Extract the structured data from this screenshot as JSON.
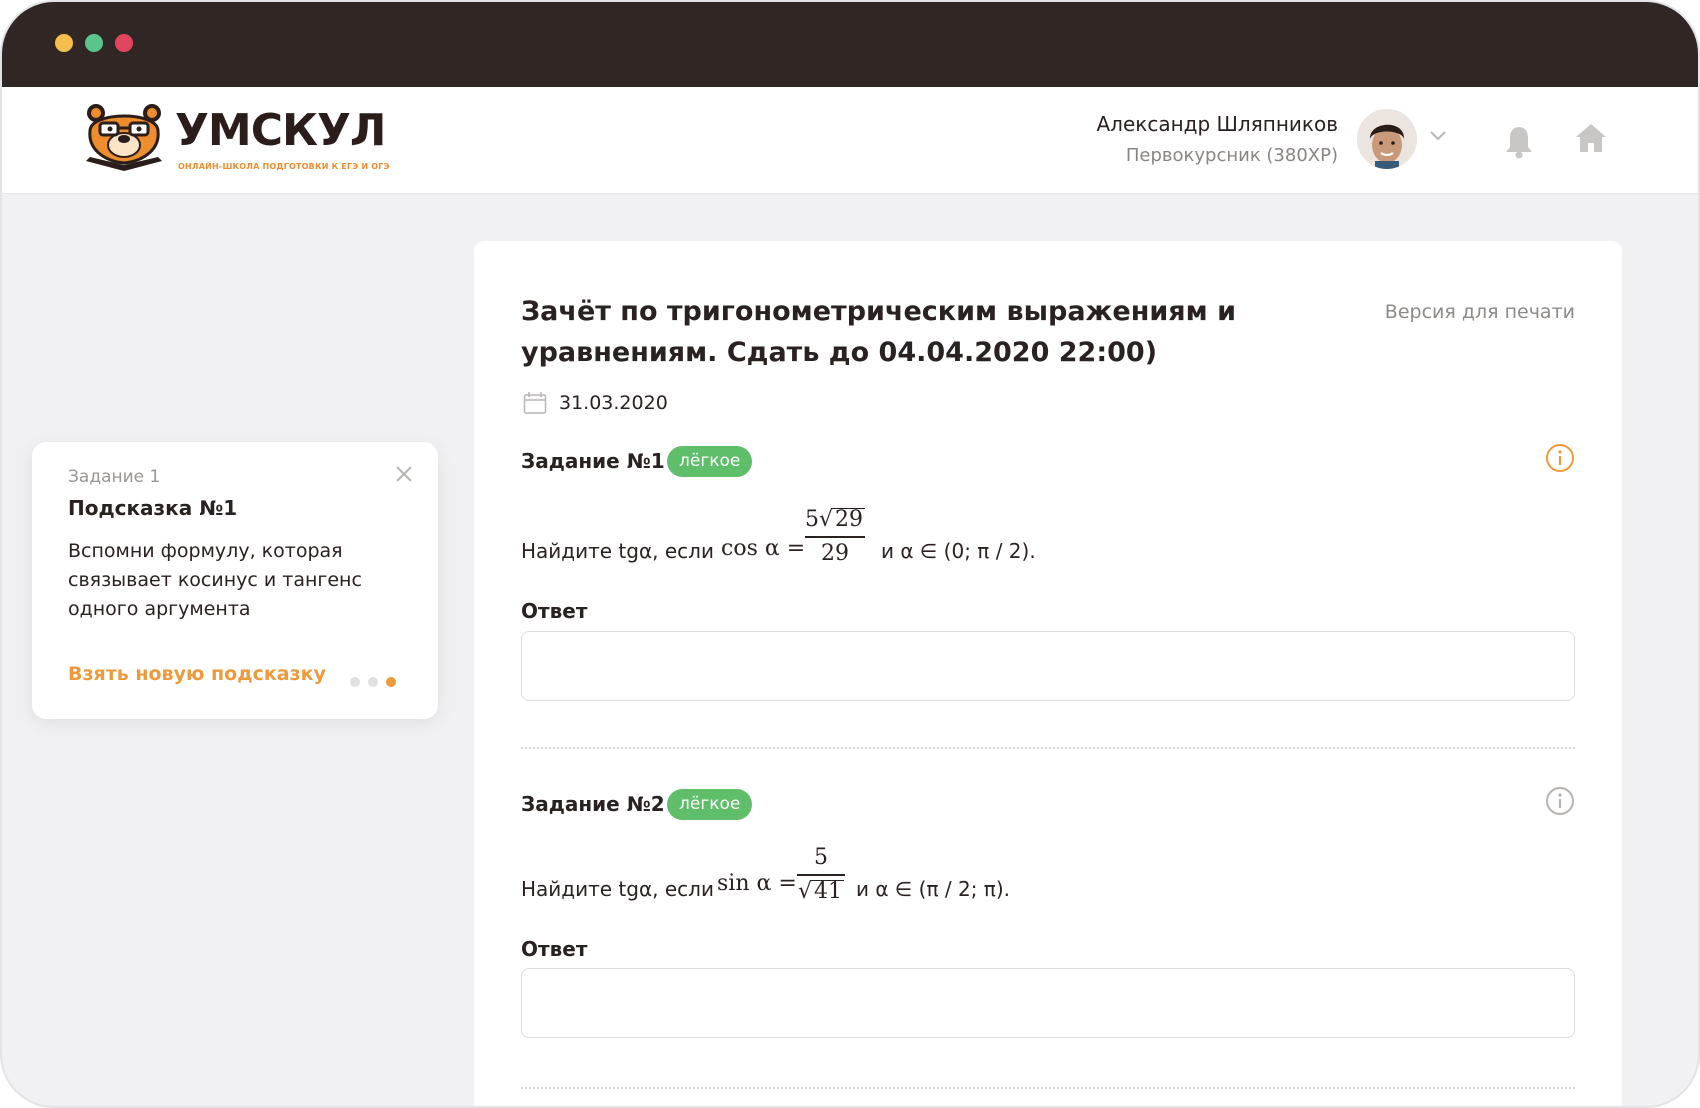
{
  "window": {
    "dots": [
      "yellow",
      "green",
      "red"
    ]
  },
  "header": {
    "logo": {
      "title": "УМСКУЛ",
      "subtitle": "ОНЛАЙН-ШКОЛА ПОДГОТОВКИ К ЕГЭ И ОГЭ",
      "icon": "bear-logo"
    },
    "user": {
      "name": "Александр Шляпников",
      "level": "Первокурсник (380XP)"
    },
    "icons": [
      "chevron-down-icon",
      "bell-icon",
      "home-icon"
    ]
  },
  "hint": {
    "task": "Задание 1",
    "title": "Подсказка №1",
    "text": "Вспомни формулу, которая связывает косинус и тангенс одного аргумента",
    "link": "Взять новую подсказку",
    "pager": {
      "total": 3,
      "active": 3
    }
  },
  "main": {
    "title": "Зачёт по тригонометрическим выражениям и уравнениям. Сдать до 04.04.2020 22:00)",
    "print_link": "Версия для печати",
    "date": "31.03.2020",
    "tasks": [
      {
        "title": "Задание №1",
        "badge": "лёгкое",
        "lead": "Найдите tgα, если",
        "fn": "cos α =",
        "num_coef": "5",
        "num_sqrt": "29",
        "den": "29",
        "trail": "и α ∈ (0; π / 2).",
        "answer_label": "Ответ",
        "answer_value": "",
        "info_color": "#ee9a3c"
      },
      {
        "title": "Задание №2",
        "badge": "лёгкое",
        "lead": "Найдите tgα, если",
        "fn": "sin α =",
        "num": "5",
        "den_sqrt": "41",
        "trail": "и α ∈ (π / 2; π).",
        "answer_label": "Ответ",
        "answer_value": "",
        "info_color": "#b5b2b0"
      }
    ]
  },
  "colors": {
    "accent": "#ee9a3c",
    "badge": "#5fbe6a",
    "titlebar": "#302724"
  }
}
